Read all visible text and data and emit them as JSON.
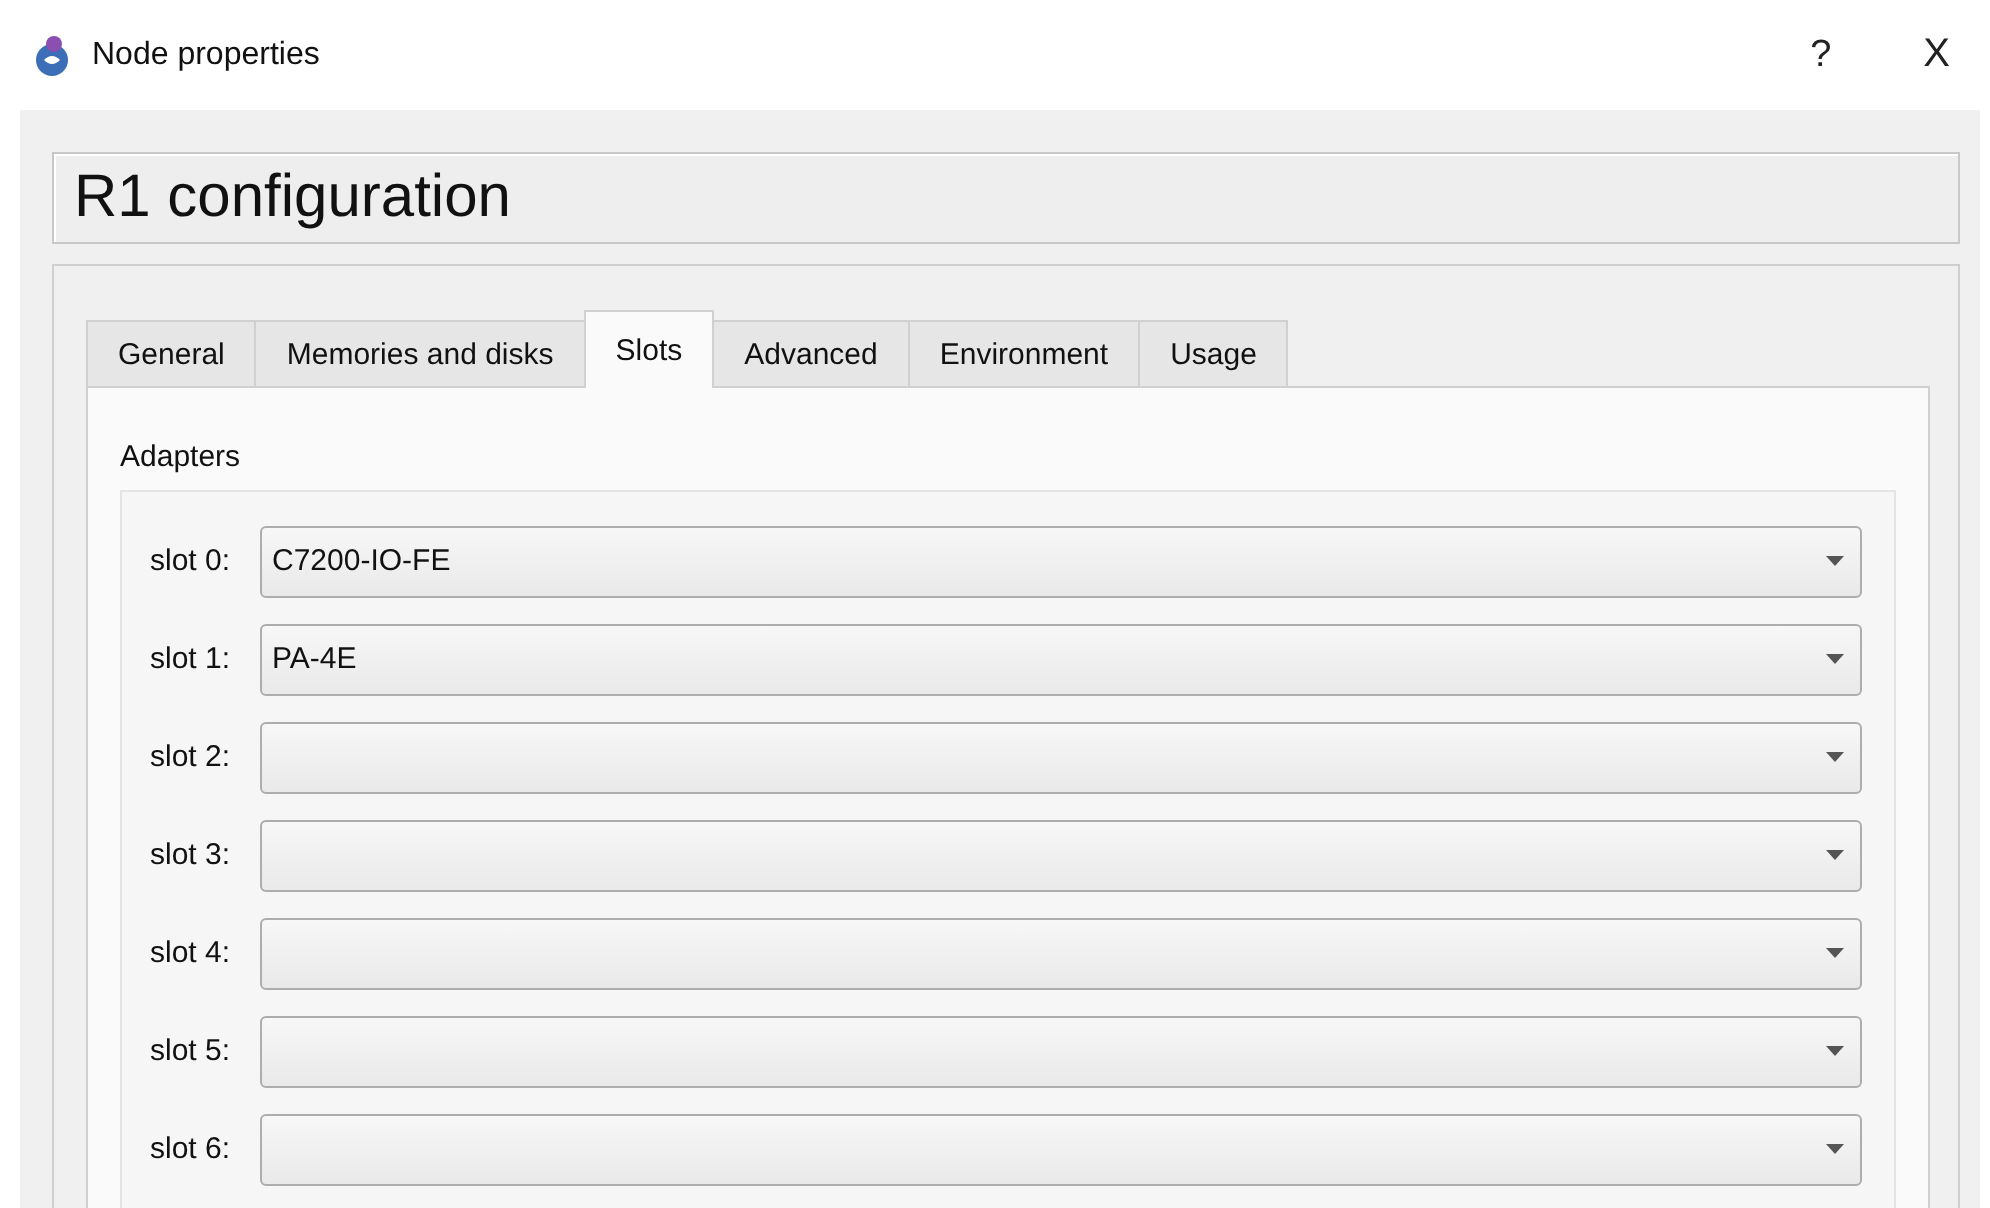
{
  "window": {
    "title": "Node properties",
    "help": "?",
    "close": "X"
  },
  "header": {
    "title": "R1 configuration"
  },
  "tabs": [
    {
      "label": "General",
      "selected": false
    },
    {
      "label": "Memories and disks",
      "selected": false
    },
    {
      "label": "Slots",
      "selected": true
    },
    {
      "label": "Advanced",
      "selected": false
    },
    {
      "label": "Environment",
      "selected": false
    },
    {
      "label": "Usage",
      "selected": false
    }
  ],
  "adapters": {
    "title": "Adapters",
    "slots": [
      {
        "label": "slot 0:",
        "value": "C7200-IO-FE"
      },
      {
        "label": "slot 1:",
        "value": "PA-4E"
      },
      {
        "label": "slot 2:"
      },
      {
        "label": "slot 3:"
      },
      {
        "label": "slot 4:"
      },
      {
        "label": "slot 5:"
      },
      {
        "label": "slot 6:"
      }
    ]
  }
}
